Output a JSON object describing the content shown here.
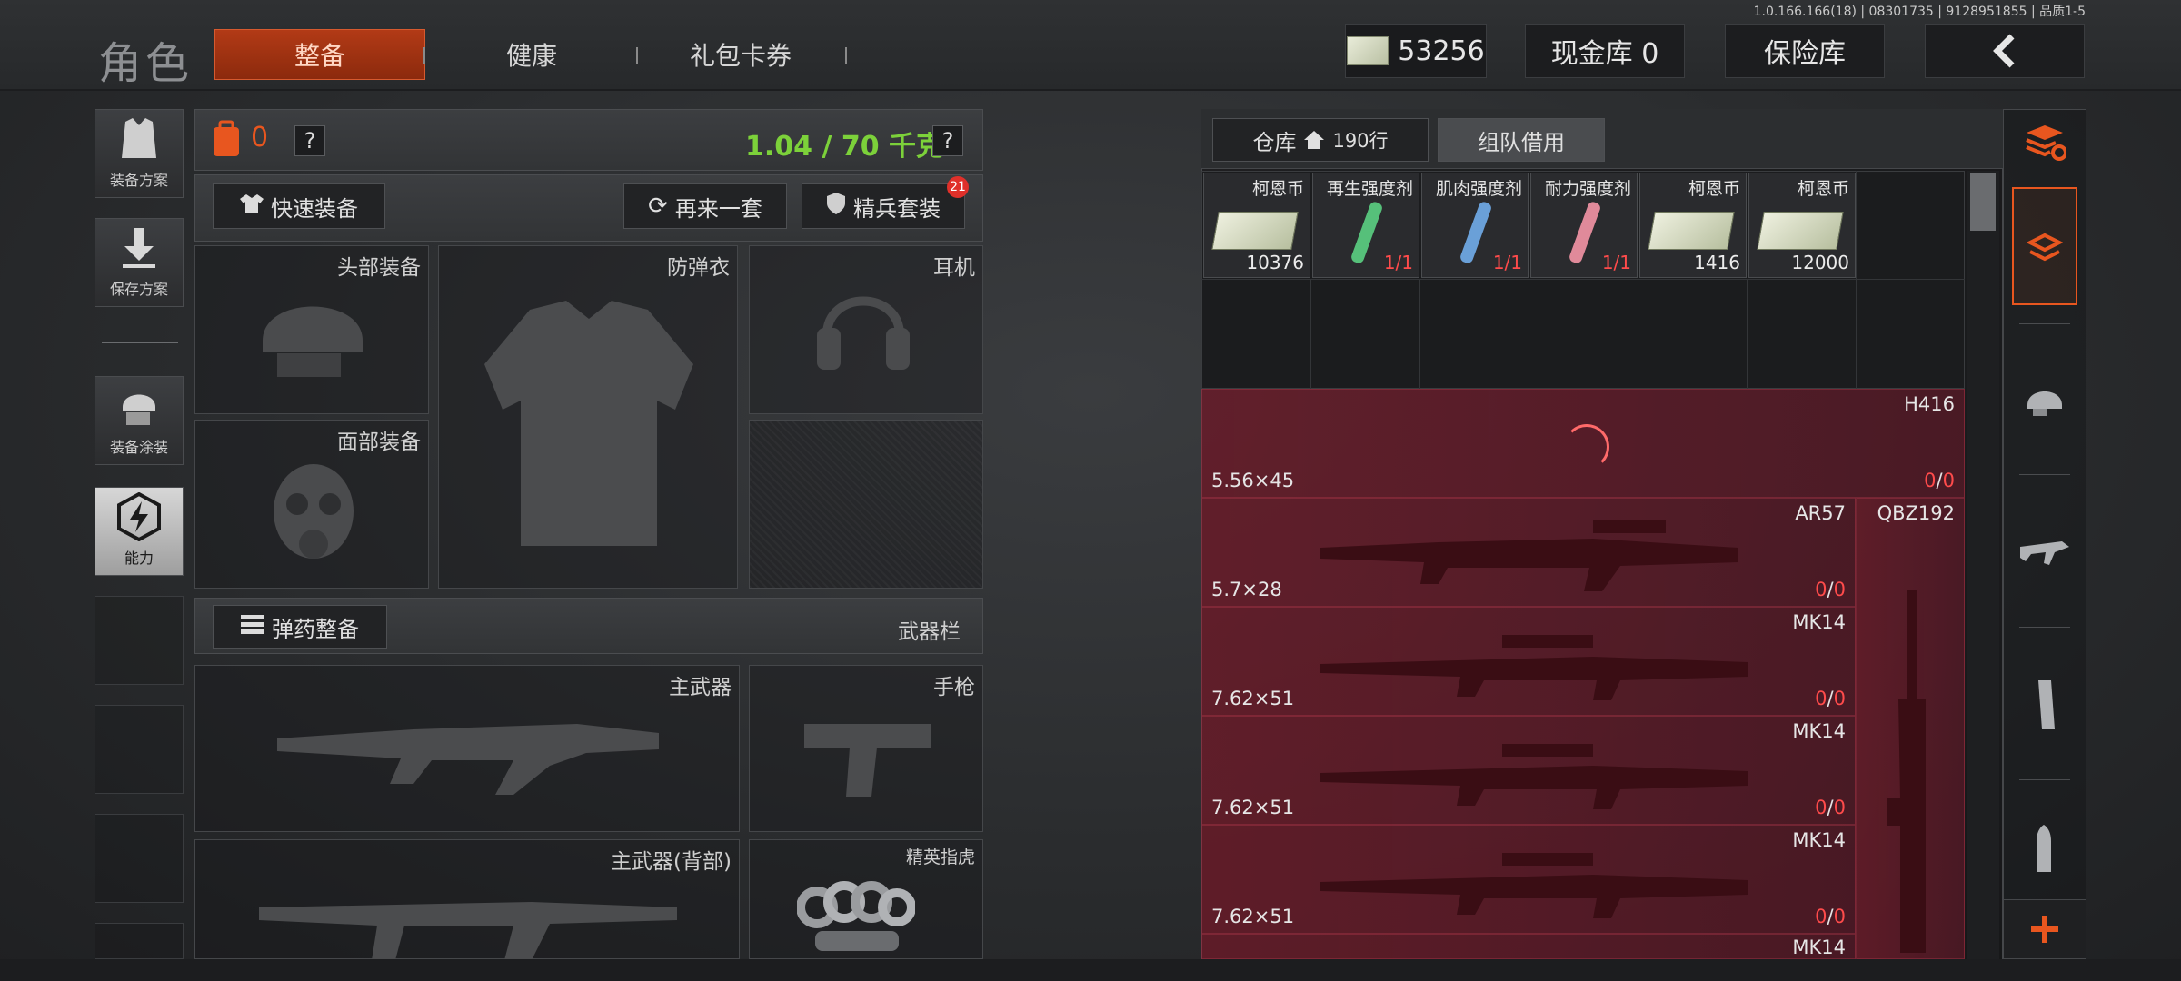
{
  "version": "1.0.166.166(18) | 08301735 | 9128951855 | 品质1-5",
  "header": {
    "title": "角色",
    "tabs": [
      {
        "label": "整备",
        "active": true
      },
      {
        "label": "健康",
        "active": false
      },
      {
        "label": "礼包卡券",
        "active": false
      }
    ],
    "currency_value": "53256",
    "cash_vault_label": "现金库 0",
    "insurance_label": "保险库"
  },
  "left_rail": {
    "items": [
      {
        "label": "装备方案",
        "icon": "vest-icon"
      },
      {
        "label": "保存方案",
        "icon": "download-icon"
      },
      {
        "label": "装备涂装",
        "icon": "helmet-paint-icon"
      },
      {
        "label": "能力",
        "icon": "lightning-hex-icon",
        "active": true
      }
    ]
  },
  "loadout": {
    "backpack_count": "0",
    "weight": "1.04 / 70 千克",
    "help": "?",
    "quick_equip": "快速装备",
    "again_set": "再来一套",
    "elite_set": "精兵套装",
    "elite_badge": "21",
    "slots": {
      "head": "头部装备",
      "armor": "防弹衣",
      "headset": "耳机",
      "face": "面部装备"
    },
    "ammo_equip": "弹药整备",
    "weapon_bar": "武器栏",
    "weapons": {
      "primary": "主武器",
      "pistol": "手枪",
      "primary_back": "主武器(背部)",
      "melee": "精英指虎"
    }
  },
  "warehouse": {
    "tab_storage": "仓库",
    "rows": "190行",
    "tab_team": "组队借用",
    "items": [
      {
        "name": "柯恩币",
        "count": "10376",
        "type": "cash"
      },
      {
        "name": "再生强度剂",
        "count": "1/1",
        "type": "syringe",
        "color": "#56c07a"
      },
      {
        "name": "肌肉强度剂",
        "count": "1/1",
        "type": "syringe",
        "color": "#6aa0d8"
      },
      {
        "name": "耐力强度剂",
        "count": "1/1",
        "type": "syringe",
        "color": "#e08a9a"
      },
      {
        "name": "柯恩币",
        "count": "1416",
        "type": "cash"
      },
      {
        "name": "柯恩币",
        "count": "12000",
        "type": "cash"
      }
    ],
    "weapons": [
      {
        "name": "H416",
        "caliber": "5.56×45",
        "ammo_a": "0",
        "ammo_b": "0"
      },
      {
        "name": "AR57",
        "caliber": "5.7×28",
        "ammo_a": "0",
        "ammo_b": "0"
      },
      {
        "name": "MK14",
        "caliber": "7.62×51",
        "ammo_a": "0",
        "ammo_b": "0"
      },
      {
        "name": "MK14",
        "caliber": "7.62×51",
        "ammo_a": "0",
        "ammo_b": "0"
      },
      {
        "name": "MK14",
        "caliber": "7.62×51",
        "ammo_a": "0",
        "ammo_b": "0"
      },
      {
        "name": "MK14",
        "caliber": "",
        "ammo_a": "",
        "ammo_b": ""
      }
    ],
    "tall_weapon": "QBZ192"
  },
  "colors": {
    "accent_orange": "#e8561f",
    "weight_green": "#7cd13a",
    "ammo_red": "#ff4b4b",
    "weapon_red": "#c02a3a"
  }
}
